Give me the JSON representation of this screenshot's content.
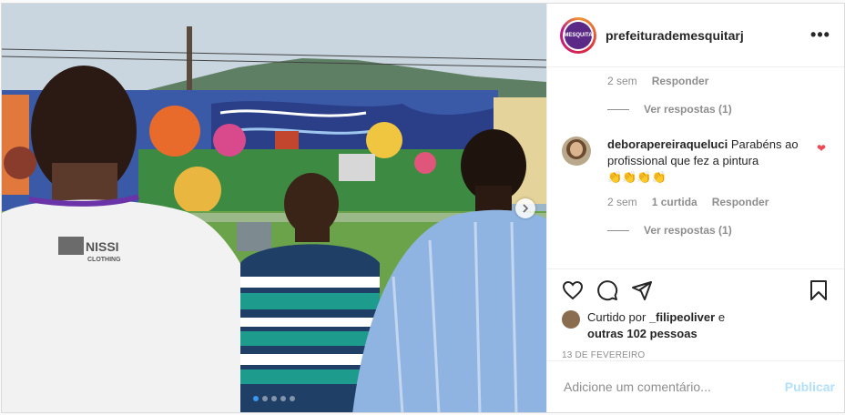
{
  "post": {
    "username": "prefeiturademesquitarj",
    "avatar_text": "MESQUITA",
    "more_label": "•••",
    "shirt_brand": "NISSI",
    "shirt_brand_sub": "CLOTHING",
    "carousel": {
      "count": 5,
      "active_index": 0
    }
  },
  "comments": {
    "first_meta": {
      "time": "2 sem",
      "reply": "Responder"
    },
    "first_view_replies": "Ver respostas (1)",
    "second": {
      "username": "deborapereiraqueluci",
      "text": "Parabéns ao profissional que fez a pintura",
      "emoji": "👏👏👏👏",
      "time": "2 sem",
      "likes": "1 curtida",
      "reply": "Responder",
      "view_replies": "Ver respostas (1)"
    }
  },
  "likes": {
    "prefix": "Curtido por",
    "user": "_filipeoliver",
    "suffix": "e",
    "others": "outras 102 pessoas"
  },
  "date": "13 DE FEVEREIRO",
  "add_comment": {
    "placeholder": "Adicione um comentário...",
    "publish": "Publicar"
  },
  "colors": {
    "accent": "#3897f0",
    "liked": "#ed4956",
    "publish_disabled": "#b2dffc"
  }
}
